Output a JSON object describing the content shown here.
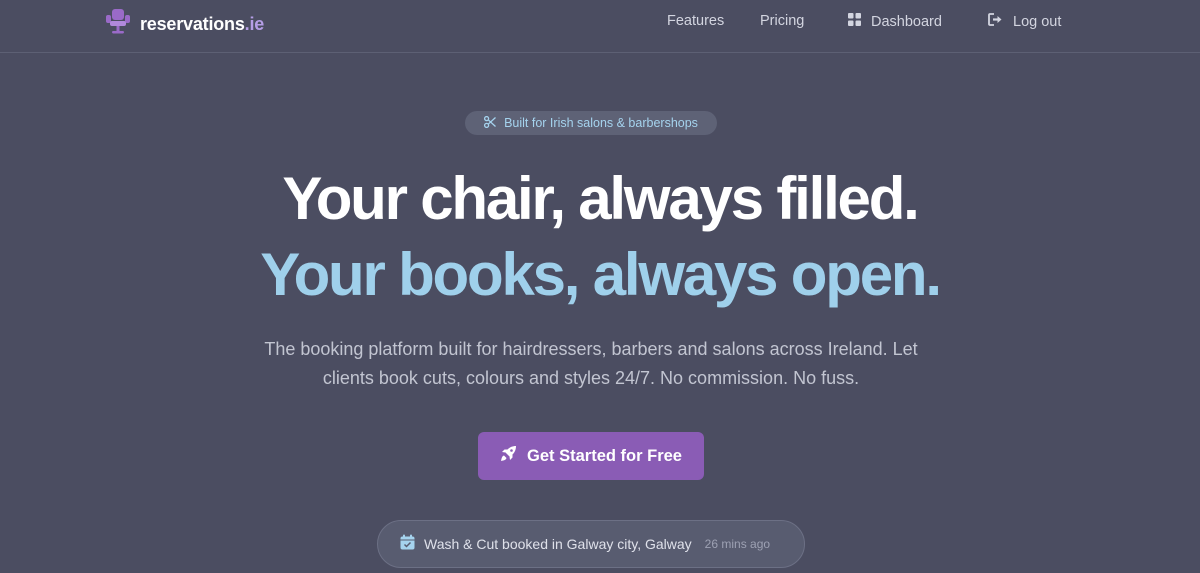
{
  "brand": {
    "name": "reservations",
    "tld": ".ie",
    "icon": "barber-chair-icon",
    "accent_color": "#b59ee6"
  },
  "nav": {
    "features": "Features",
    "pricing": "Pricing",
    "dashboard": "Dashboard",
    "logout": "Log out"
  },
  "hero": {
    "badge": "Built for Irish salons & barbershops",
    "badge_icon": "scissors-icon",
    "headline_1": "Your chair, always filled.",
    "headline_2": "Your books, always open.",
    "subtitle": "The booking platform built for hairdressers, barbers and salons across Ireland. Let clients book cuts, colours and styles 24/7. No commission. No fuss.",
    "cta": "Get Started for Free",
    "cta_icon": "rocket-icon",
    "cta_color": "#8a5cb5",
    "headline_2_color": "#9fd0eb"
  },
  "notification": {
    "icon": "calendar-check-icon",
    "text": "Wash & Cut booked in Galway city, Galway",
    "time": "26 mins ago"
  }
}
